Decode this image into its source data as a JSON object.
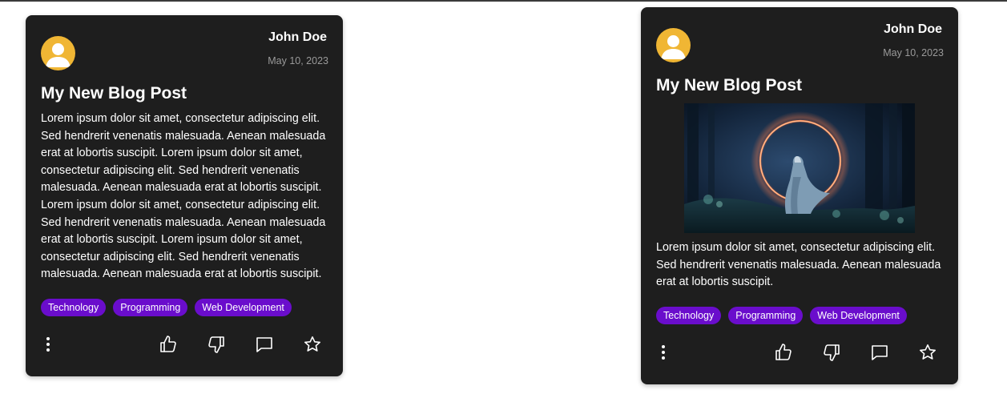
{
  "posts": [
    {
      "author": "John Doe",
      "date": "May 10, 2023",
      "title": "My New Blog Post",
      "body": "Lorem ipsum dolor sit amet, consectetur adipiscing elit. Sed hendrerit venenatis malesuada. Aenean malesuada erat at lobortis suscipit. Lorem ipsum dolor sit amet, consectetur adipiscing elit. Sed hendrerit venenatis malesuada. Aenean malesuada erat at lobortis suscipit. Lorem ipsum dolor sit amet, consectetur adipiscing elit. Sed hendrerit venenatis malesuada. Aenean malesuada erat at lobortis suscipit. Lorem ipsum dolor sit amet, consectetur adipiscing elit. Sed hendrerit venenatis malesuada. Aenean malesuada erat at lobortis suscipit.",
      "tags": [
        "Technology",
        "Programming",
        "Web Development"
      ],
      "has_image": false
    },
    {
      "author": "John Doe",
      "date": "May 10, 2023",
      "title": "My New Blog Post",
      "body": "Lorem ipsum dolor sit amet, consectetur adipiscing elit. Sed hendrerit venenatis malesuada. Aenean malesuada erat at lobortis suscipit.",
      "tags": [
        "Technology",
        "Programming",
        "Web Development"
      ],
      "has_image": true
    }
  ],
  "icons": {
    "avatar": "user-avatar-icon",
    "more": "more-vertical-icon",
    "like": "thumbs-up-icon",
    "dislike": "thumbs-down-icon",
    "comment": "comment-icon",
    "favorite": "star-icon"
  },
  "colors": {
    "card_background": "#1e1e1e",
    "tag_background": "#6a0dcc",
    "avatar_background": "#f0b634",
    "date_text": "#9a9a9a"
  }
}
